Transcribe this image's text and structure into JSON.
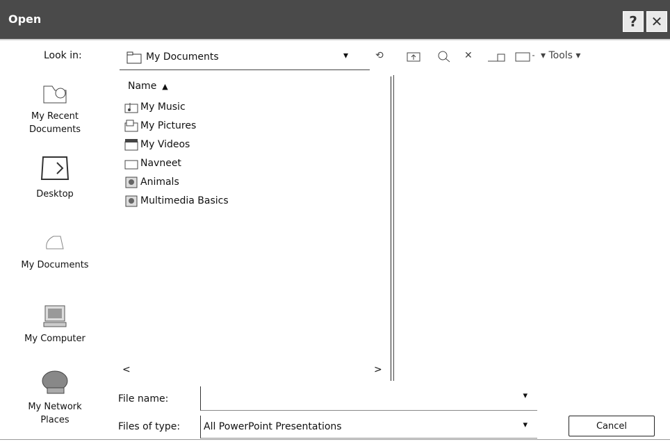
{
  "window": {
    "title": "Open"
  },
  "toolbar": {
    "lookin_label": "Look in:",
    "lookin_value": "My Documents",
    "tools_label": "Tools"
  },
  "places": [
    {
      "label1": "My Recent",
      "label2": "Documents"
    },
    {
      "label1": "Desktop",
      "label2": ""
    },
    {
      "label1": "My Documents",
      "label2": ""
    },
    {
      "label1": "My Computer",
      "label2": ""
    },
    {
      "label1": "My Network",
      "label2": "Places"
    }
  ],
  "filelist": {
    "column_header": "Name",
    "items": [
      "My Music",
      "My Pictures",
      "My Videos",
      "Navneet",
      "Animals",
      "Multimedia Basics"
    ]
  },
  "form": {
    "filename_label": "File name:",
    "filename_value": "",
    "filetype_label": "Files of type:",
    "filetype_value": "All PowerPoint Presentations",
    "cancel_label": "Cancel"
  }
}
